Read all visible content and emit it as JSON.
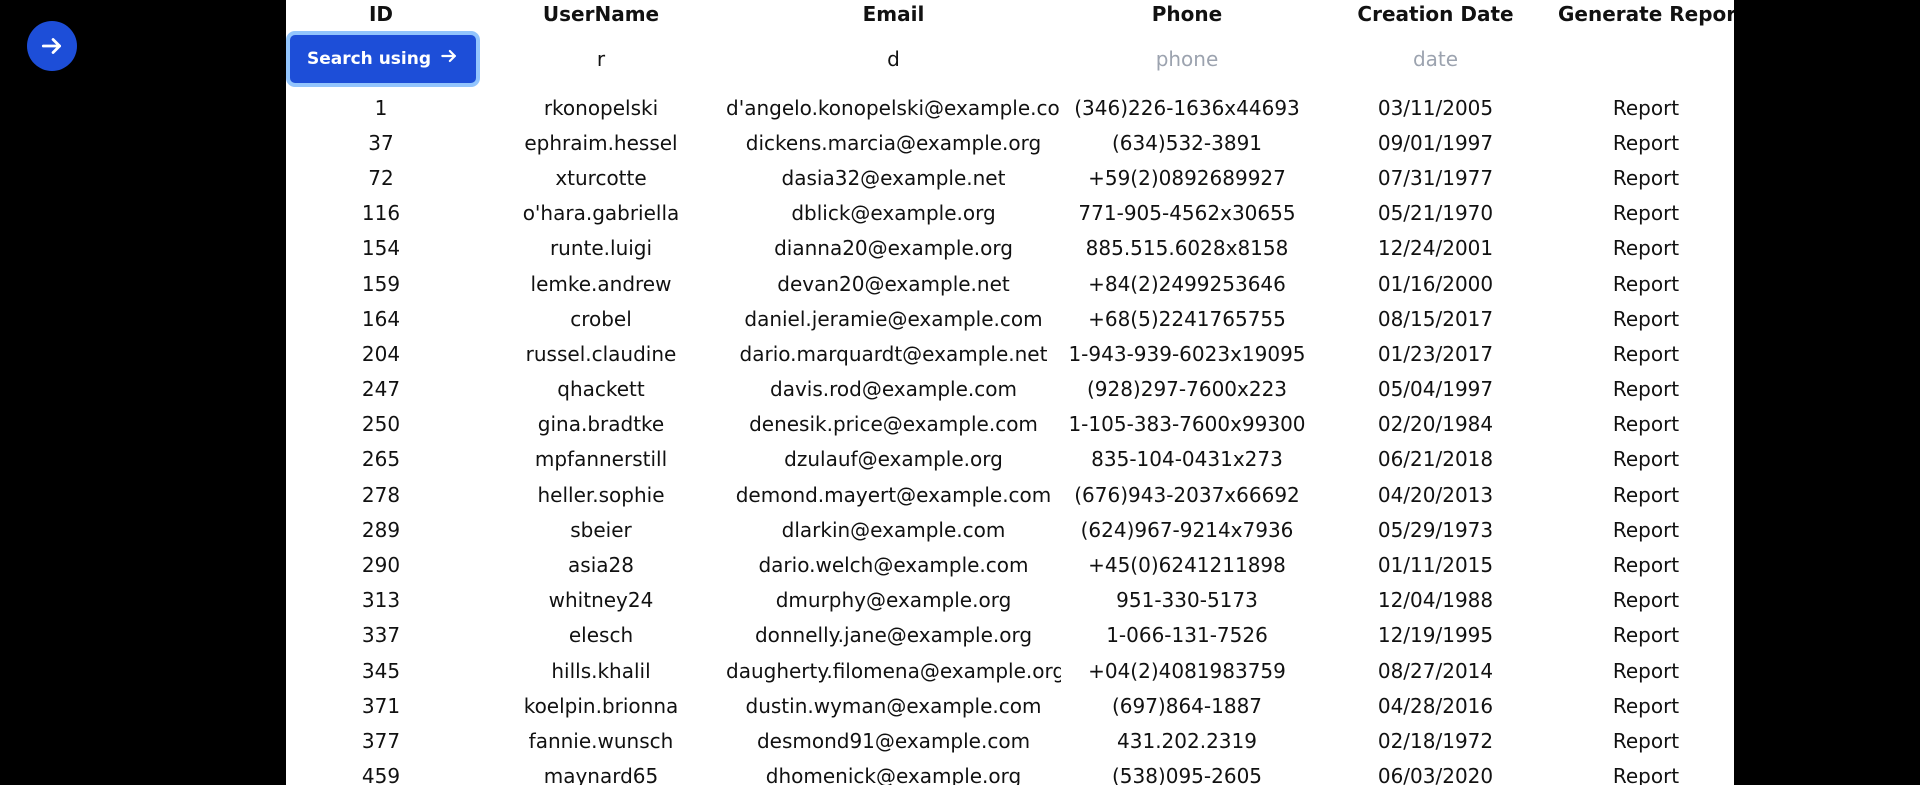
{
  "nav": {
    "icon": "arrow-right-icon"
  },
  "table": {
    "headers": [
      "ID",
      "UserName",
      "Email",
      "Phone",
      "Creation Date",
      "Generate Report"
    ],
    "filters": {
      "search_button_label": "Search using",
      "search_button_icon": "arrow-right-icon",
      "username_value": "r",
      "email_value": "d",
      "phone_placeholder": "phone",
      "date_placeholder": "date"
    },
    "rows": [
      {
        "id": "1",
        "username": "rkonopelski",
        "email": "d'angelo.konopelski@example.com",
        "phone": "(346)226-1636x44693",
        "date": "03/11/2005",
        "report": "Report"
      },
      {
        "id": "37",
        "username": "ephraim.hessel",
        "email": "dickens.marcia@example.org",
        "phone": "(634)532-3891",
        "date": "09/01/1997",
        "report": "Report"
      },
      {
        "id": "72",
        "username": "xturcotte",
        "email": "dasia32@example.net",
        "phone": "+59(2)0892689927",
        "date": "07/31/1977",
        "report": "Report"
      },
      {
        "id": "116",
        "username": "o'hara.gabriella",
        "email": "dblick@example.org",
        "phone": "771-905-4562x30655",
        "date": "05/21/1970",
        "report": "Report"
      },
      {
        "id": "154",
        "username": "runte.luigi",
        "email": "dianna20@example.org",
        "phone": "885.515.6028x8158",
        "date": "12/24/2001",
        "report": "Report"
      },
      {
        "id": "159",
        "username": "lemke.andrew",
        "email": "devan20@example.net",
        "phone": "+84(2)2499253646",
        "date": "01/16/2000",
        "report": "Report"
      },
      {
        "id": "164",
        "username": "crobel",
        "email": "daniel.jeramie@example.com",
        "phone": "+68(5)2241765755",
        "date": "08/15/2017",
        "report": "Report"
      },
      {
        "id": "204",
        "username": "russel.claudine",
        "email": "dario.marquardt@example.net",
        "phone": "1-943-939-6023x19095",
        "date": "01/23/2017",
        "report": "Report"
      },
      {
        "id": "247",
        "username": "qhackett",
        "email": "davis.rod@example.com",
        "phone": "(928)297-7600x223",
        "date": "05/04/1997",
        "report": "Report"
      },
      {
        "id": "250",
        "username": "gina.bradtke",
        "email": "denesik.price@example.com",
        "phone": "1-105-383-7600x99300",
        "date": "02/20/1984",
        "report": "Report"
      },
      {
        "id": "265",
        "username": "mpfannerstill",
        "email": "dzulauf@example.org",
        "phone": "835-104-0431x273",
        "date": "06/21/2018",
        "report": "Report"
      },
      {
        "id": "278",
        "username": "heller.sophie",
        "email": "demond.mayert@example.com",
        "phone": "(676)943-2037x66692",
        "date": "04/20/2013",
        "report": "Report"
      },
      {
        "id": "289",
        "username": "sbeier",
        "email": "dlarkin@example.com",
        "phone": "(624)967-9214x7936",
        "date": "05/29/1973",
        "report": "Report"
      },
      {
        "id": "290",
        "username": "asia28",
        "email": "dario.welch@example.com",
        "phone": "+45(0)6241211898",
        "date": "01/11/2015",
        "report": "Report"
      },
      {
        "id": "313",
        "username": "whitney24",
        "email": "dmurphy@example.org",
        "phone": "951-330-5173",
        "date": "12/04/1988",
        "report": "Report"
      },
      {
        "id": "337",
        "username": "elesch",
        "email": "donnelly.jane@example.org",
        "phone": "1-066-131-7526",
        "date": "12/19/1995",
        "report": "Report"
      },
      {
        "id": "345",
        "username": "hills.khalil",
        "email": "daugherty.filomena@example.org",
        "phone": "+04(2)4081983759",
        "date": "08/27/2014",
        "report": "Report"
      },
      {
        "id": "371",
        "username": "koelpin.brionna",
        "email": "dustin.wyman@example.com",
        "phone": "(697)864-1887",
        "date": "04/28/2016",
        "report": "Report"
      },
      {
        "id": "377",
        "username": "fannie.wunsch",
        "email": "desmond91@example.com",
        "phone": "431.202.2319",
        "date": "02/18/1972",
        "report": "Report"
      },
      {
        "id": "459",
        "username": "maynard65",
        "email": "dhomenick@example.org",
        "phone": "(538)095-2605",
        "date": "06/03/2020",
        "report": "Report"
      }
    ]
  },
  "colors": {
    "background": "#000000",
    "panel": "#ffffff",
    "accent": "#1d4ed8",
    "focus_ring": "#93c5fd",
    "placeholder": "#9ca3af"
  }
}
